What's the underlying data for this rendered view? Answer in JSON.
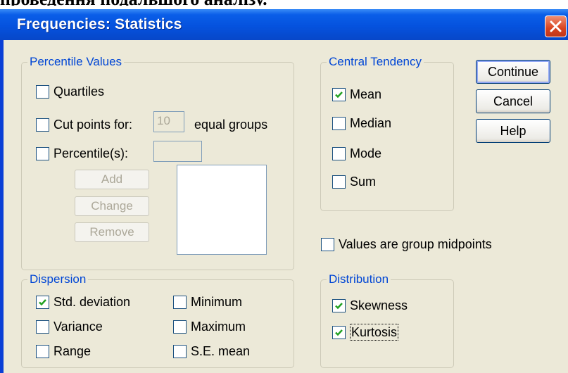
{
  "background_text": "проведення подальшого аналізу.",
  "window": {
    "title": "Frequencies: Statistics",
    "close_label": "X"
  },
  "percentile_values": {
    "legend": "Percentile Values",
    "quartiles": {
      "label": "Quartiles",
      "checked": false
    },
    "cut_points": {
      "label": "Cut points for:",
      "checked": false,
      "value": "10",
      "suffix": "equal groups"
    },
    "percentiles": {
      "label": "Percentile(s):",
      "checked": false,
      "value": ""
    },
    "add_label": "Add",
    "change_label": "Change",
    "remove_label": "Remove"
  },
  "central_tendency": {
    "legend": "Central Tendency",
    "items": [
      {
        "label": "Mean",
        "checked": true
      },
      {
        "label": "Median",
        "checked": false
      },
      {
        "label": "Mode",
        "checked": false
      },
      {
        "label": "Sum",
        "checked": false
      }
    ]
  },
  "buttons": {
    "continue": "Continue",
    "cancel": "Cancel",
    "help": "Help"
  },
  "group_midpoints": {
    "label": "Values are group midpoints",
    "checked": false
  },
  "dispersion": {
    "legend": "Dispersion",
    "items": [
      {
        "label": "Std. deviation",
        "checked": true
      },
      {
        "label": "Variance",
        "checked": false
      },
      {
        "label": "Range",
        "checked": false
      },
      {
        "label": "Minimum",
        "checked": false
      },
      {
        "label": "Maximum",
        "checked": false
      },
      {
        "label": "S.E. mean",
        "checked": false
      }
    ]
  },
  "distribution": {
    "legend": "Distribution",
    "items": [
      {
        "label": "Skewness",
        "checked": true
      },
      {
        "label": "Kurtosis",
        "checked": true
      }
    ]
  },
  "colors": {
    "titlebar": "#0552de",
    "client": "#ece9d8",
    "legend_text": "#0046d5",
    "checkmark": "#21a121",
    "close_button": "#d9431f"
  }
}
